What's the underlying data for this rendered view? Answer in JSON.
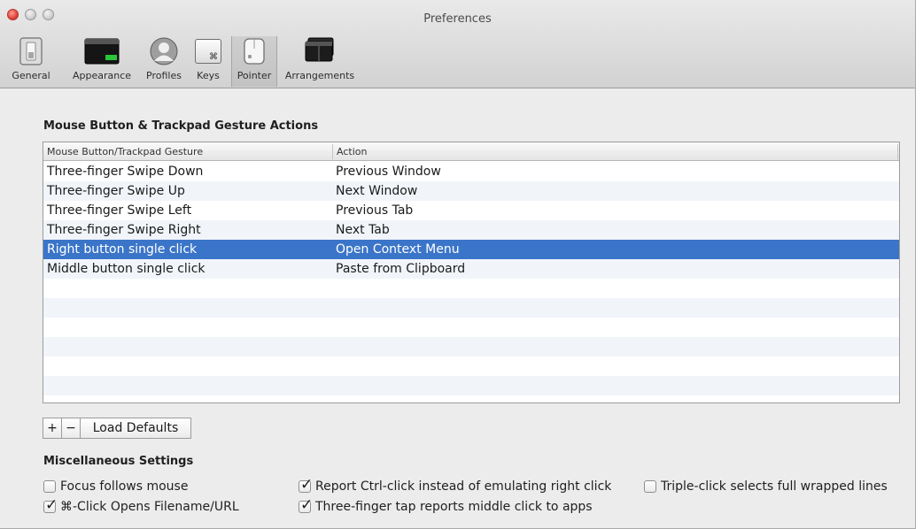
{
  "window": {
    "title": "Preferences"
  },
  "toolbar": {
    "items": [
      {
        "label": "General",
        "icon": "switch-icon"
      },
      {
        "label": "Appearance",
        "icon": "window-icon"
      },
      {
        "label": "Profiles",
        "icon": "profile-icon"
      },
      {
        "label": "Keys",
        "icon": "command-key-icon",
        "glyph": "⌘"
      },
      {
        "label": "Pointer",
        "icon": "mouse-icon",
        "selected": true
      },
      {
        "label": "Arrangements",
        "icon": "arrangement-icon"
      }
    ]
  },
  "actions": {
    "title": "Mouse Button & Trackpad Gesture Actions",
    "columns": [
      "Mouse Button/Trackpad Gesture",
      "Action"
    ],
    "rows": [
      {
        "gesture": "Three-finger Swipe Down",
        "action": "Previous Window"
      },
      {
        "gesture": "Three-finger Swipe Up",
        "action": "Next Window"
      },
      {
        "gesture": "Three-finger Swipe Left",
        "action": "Previous Tab"
      },
      {
        "gesture": "Three-finger Swipe Right",
        "action": "Next Tab"
      },
      {
        "gesture": "Right button single click",
        "action": "Open Context Menu",
        "selected": true
      },
      {
        "gesture": "Middle button single click",
        "action": "Paste from Clipboard"
      }
    ],
    "add_label": "+",
    "remove_label": "−",
    "load_defaults_label": "Load Defaults"
  },
  "misc": {
    "title": "Miscellaneous Settings",
    "options": [
      {
        "label": "Focus follows mouse",
        "checked": false
      },
      {
        "label": "⌘-Click Opens Filename/URL",
        "checked": true
      },
      {
        "label": "Report Ctrl-click instead of emulating right click",
        "checked": true
      },
      {
        "label": "Three-finger tap reports middle click to apps",
        "checked": true
      },
      {
        "label": "Triple-click selects full wrapped lines",
        "checked": false
      }
    ]
  },
  "colors": {
    "selection": "#3b75c9",
    "stripe": "#f1f5fa",
    "close": "#e0443a"
  }
}
